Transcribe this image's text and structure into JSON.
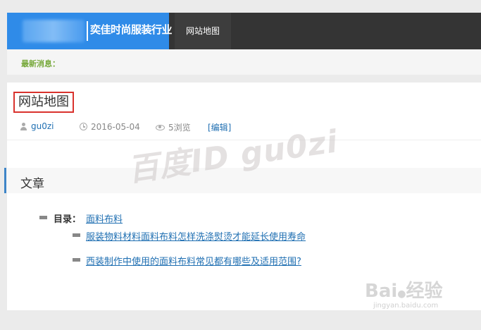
{
  "header": {
    "logo_text": "奕佳时尚服装行业",
    "nav": [
      {
        "label": "网站地图"
      }
    ]
  },
  "news": {
    "label": "最新消息："
  },
  "article": {
    "title": "网站地图",
    "author": "gu0zi",
    "date": "2016-05-04",
    "views": "5浏览",
    "edit": "[编辑]"
  },
  "section": {
    "title": "文章",
    "toc_label": "目录：",
    "category": "面料布料",
    "links": [
      "服装物料材料面料布料怎样洗涤熨烫才能延长使用寿命",
      "西装制作中使用的面料布料常见都有哪些及适用范围?"
    ]
  },
  "watermark": {
    "main": "百度ID gu0zi",
    "baidu": "Bai",
    "baidu_cn": "经验",
    "baidu_url": "jingyan.baidu.com"
  },
  "colors": {
    "logo_bg": "#2f8be8",
    "nav_bg": "#343434",
    "news_label": "#76a83a",
    "link": "#1f6fb2",
    "highlight_border": "#d9322d",
    "section_accent": "#3e85c7"
  }
}
